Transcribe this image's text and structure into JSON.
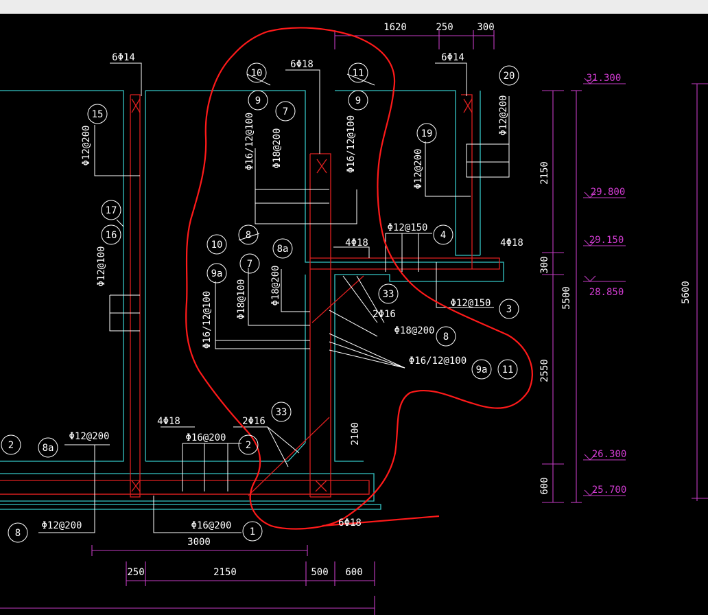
{
  "drawing": {
    "dimensions_top": [
      "1620",
      "250",
      "300"
    ],
    "dimensions_bottom": [
      "250",
      "2150",
      "500",
      "600"
    ],
    "dimension_3000": "3000",
    "dimension_2100": "2100",
    "dimensions_right": [
      "2150",
      "300",
      "2550",
      "600"
    ],
    "dimension_5500": "5500",
    "dimension_5600": "5600",
    "elevations": [
      "31.300",
      "29.800",
      "29.150",
      "28.850",
      "26.300",
      "25.700"
    ],
    "rebar_notes": {
      "t1": "6Φ14",
      "t2": "6Φ18",
      "t3": "6Φ14",
      "t4": "Φ12@200",
      "t5": "Φ12@100",
      "t6": "Φ16/12@100",
      "t7": "Φ18@200",
      "t8": "Φ16/12@100",
      "t9": "Φ12@200",
      "t10": "Φ12@200",
      "t11": "4Φ18",
      "t12": "Φ12@150",
      "t13": "4Φ18",
      "t14": "Φ12@150",
      "t15": "Φ16/12@100",
      "t16": "Φ18@100",
      "t17": "Φ18@200",
      "t18": "2Φ16",
      "t19": "Φ18@200",
      "t20": "Φ16/12@100",
      "t21": "Φ12@200",
      "t22": "4Φ18",
      "t23": "Φ16@200",
      "t24": "2Φ16",
      "t25": "Φ12@200",
      "t26": "Φ16@200",
      "t27": "6Φ18"
    },
    "bubbles": {
      "b1": "15",
      "b2": "17",
      "b3": "16",
      "b4": "10",
      "b5": "9",
      "b6": "7",
      "b7": "11",
      "b8": "9",
      "b9": "20",
      "b10": "19",
      "b11": "10",
      "b12": "9a",
      "b13": "8",
      "b14": "7",
      "b15": "8a",
      "b16": "4",
      "b17": "33",
      "b18": "3",
      "b19": "8",
      "b20": "9a",
      "b21": "11",
      "b22": "33",
      "b23": "2",
      "b24": "8a",
      "b25": "2",
      "b26": "8",
      "b27": "1"
    }
  }
}
